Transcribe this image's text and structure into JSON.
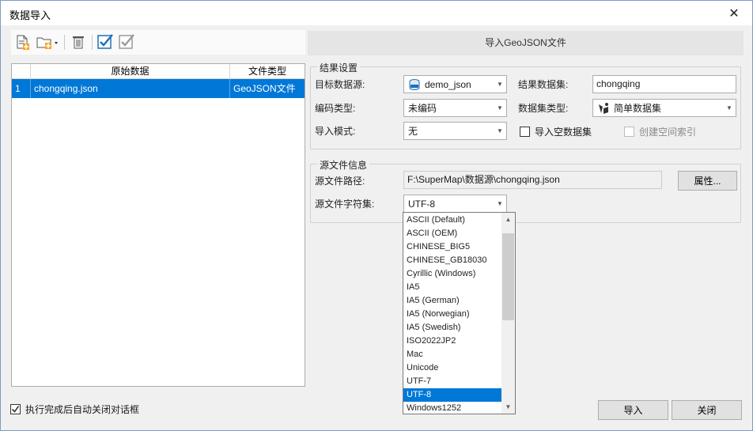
{
  "window": {
    "title": "数据导入",
    "close_glyph": "✕"
  },
  "toolbar": {
    "icons": [
      "add-file-icon",
      "add-folder-icon",
      "delete-icon",
      "select-all-icon",
      "select-inverse-icon"
    ]
  },
  "grid": {
    "columns": [
      "",
      "原始数据",
      "文件类型"
    ],
    "rows": [
      {
        "index": "1",
        "name": "chongqing.json",
        "type": "GeoJSON文件"
      }
    ]
  },
  "footer": {
    "auto_close_label": "执行完成后自动关闭对话框",
    "auto_close_checked": true,
    "import_button": "导入",
    "close_button": "关闭"
  },
  "panel": {
    "title": "导入GeoJSON文件"
  },
  "result": {
    "legend": "结果设置",
    "target_source_label": "目标数据源:",
    "target_source_value": "demo_json",
    "result_dataset_label": "结果数据集:",
    "result_dataset_value": "chongqing",
    "encoding_label": "编码类型:",
    "encoding_value": "未编码",
    "dataset_type_label": "数据集类型:",
    "dataset_type_value": "简单数据集",
    "import_mode_label": "导入模式:",
    "import_mode_value": "无",
    "import_empty_label": "导入空数据集",
    "create_index_label": "创建空间索引"
  },
  "source": {
    "legend": "源文件信息",
    "path_label": "源文件路径:",
    "path_value": "F:\\SuperMap\\数据源\\chongqing.json",
    "properties_button": "属性...",
    "charset_label": "源文件字符集:",
    "charset_value": "UTF-8"
  },
  "charset_options": [
    "ASCII (Default)",
    "ASCII (OEM)",
    "CHINESE_BIG5",
    "CHINESE_GB18030",
    "Cyrillic (Windows)",
    "IA5",
    "IA5 (German)",
    "IA5 (Norwegian)",
    "IA5 (Swedish)",
    "ISO2022JP2",
    "Mac",
    "Unicode",
    "UTF-7",
    "UTF-8",
    "Windows1252"
  ],
  "charset_selected": "UTF-8",
  "colors": {
    "accent": "#0078d7",
    "background": "#f0f0f0"
  }
}
